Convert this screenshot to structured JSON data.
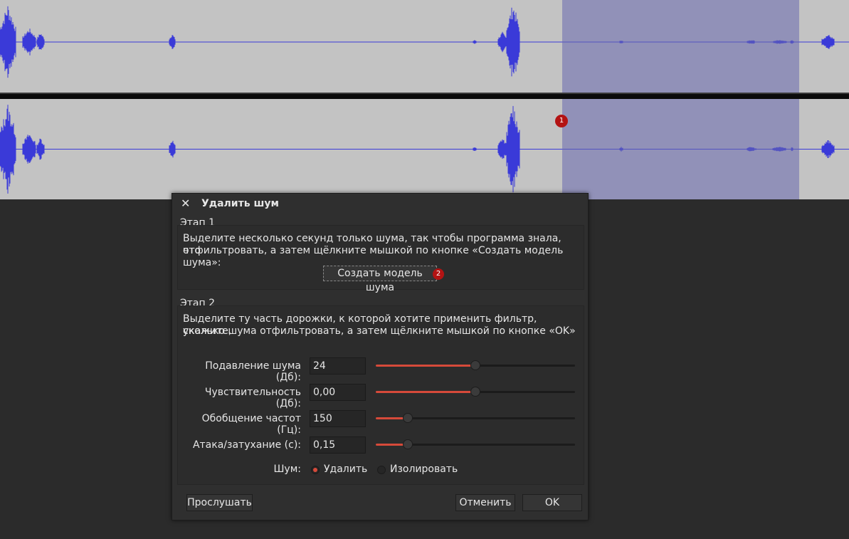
{
  "dialog": {
    "title": "Удалить шум",
    "step1": {
      "label": "Этап 1",
      "description_line1": "Выделите несколько секунд только шума, так чтобы программа знала, что",
      "description_line2": "отфильтровать, а затем щёлкните мышкой по кнопке «Создать модель шума»:",
      "button": "Создать модель шума"
    },
    "step2": {
      "label": "Этап 2",
      "description_line1": "Выделите ту часть дорожки, к которой хотите применить фильтр, укажите,",
      "description_line2": "сколько шума отфильтровать, а затем щёлкните мышкой по кнопке «OK»",
      "fields": [
        {
          "label": "Подавление шума (Дб):",
          "value": "24",
          "slider_fraction": 0.5
        },
        {
          "label": "Чувствительность (Дб):",
          "value": "0,00",
          "slider_fraction": 0.5
        },
        {
          "label": "Обобщение частот (Гц):",
          "value": "150",
          "slider_fraction": 0.16
        },
        {
          "label": "Атака/затухание (с):",
          "value": "0,15",
          "slider_fraction": 0.16
        }
      ],
      "noise_label": "Шум:",
      "noise_options": [
        {
          "label": "Удалить",
          "selected": true
        },
        {
          "label": "Изолировать",
          "selected": false
        }
      ]
    },
    "buttons": {
      "preview": "Прослушать",
      "cancel": "Отменить",
      "ok": "OK"
    }
  },
  "annotations": {
    "badge1": "1",
    "badge2": "2"
  },
  "colors": {
    "waveform": "#3a3ad8",
    "track_bg": "#c3c3c3",
    "selection": "#6868af",
    "accent": "#d64a3a",
    "badge": "#b31313"
  }
}
